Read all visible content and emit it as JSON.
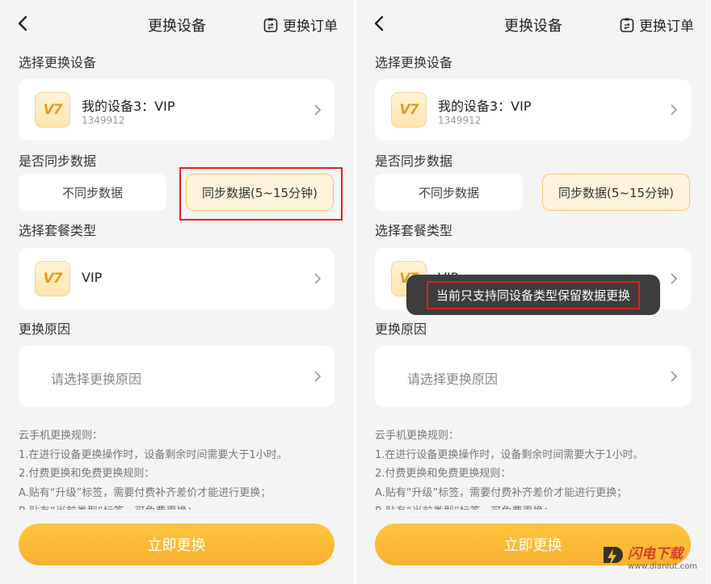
{
  "screens": [
    {
      "header": {
        "back_icon": "back-arrow-icon",
        "title": "更换设备",
        "orders_icon": "orders-icon",
        "orders_label": "更换订单"
      },
      "device_section": {
        "label": "选择更换设备",
        "device_name": "我的设备3：VIP",
        "device_id": "1349912",
        "logo_text": "V7"
      },
      "sync_section": {
        "label": "是否同步数据",
        "option_no": "不同步数据",
        "option_yes": "同步数据(5~15分钟)",
        "selected": "option_yes"
      },
      "package_section": {
        "label": "选择套餐类型",
        "package_name": "VIP",
        "logo_text": "V7"
      },
      "reason_section": {
        "label": "更换原因",
        "placeholder": "请选择更换原因"
      },
      "rules": {
        "lines": [
          "云手机更换规则：",
          "1.在进行设备更换操作时，设备剩余时间需要大于1小时。",
          "2.付费更换和免费更换规则：",
          "A.贴有“升级”标签，需要付费补齐差价才能进行更换；",
          "B.贴有“当前类型”标签，可免费更换；"
        ]
      },
      "cta_label": "立即更换"
    },
    {
      "header": {
        "back_icon": "back-arrow-icon",
        "title": "更换设备",
        "orders_icon": "orders-icon",
        "orders_label": "更换订单"
      },
      "device_section": {
        "label": "选择更换设备",
        "device_name": "我的设备3：VIP",
        "device_id": "1349912",
        "logo_text": "V7"
      },
      "sync_section": {
        "label": "是否同步数据",
        "option_no": "不同步数据",
        "option_yes": "同步数据(5~15分钟)",
        "selected": "option_yes"
      },
      "package_section": {
        "label": "选择套餐类型",
        "package_name": "VIP",
        "logo_text": "V7"
      },
      "reason_section": {
        "label": "更换原因",
        "placeholder": "请选择更换原因"
      },
      "toast": "当前只支持同设备类型保留数据更换",
      "rules": {
        "lines": [
          "云手机更换规则：",
          "1.在进行设备更换操作时，设备剩余时间需要大于1小时。",
          "2.付费更换和免费更换规则：",
          "A.贴有“升级”标签，需要付费补齐差价才能进行更换；",
          "B.贴有“当前类型”标签，可免费更换；"
        ]
      },
      "cta_label": "立即更换"
    }
  ],
  "watermark": {
    "name": "闪电下载",
    "url": "www.dianlut.com"
  },
  "colors": {
    "accent": "#f8b02e",
    "selected_bg": "#fff4dc",
    "highlight": "#e02020",
    "toast_bg": "#3d3d3d"
  }
}
